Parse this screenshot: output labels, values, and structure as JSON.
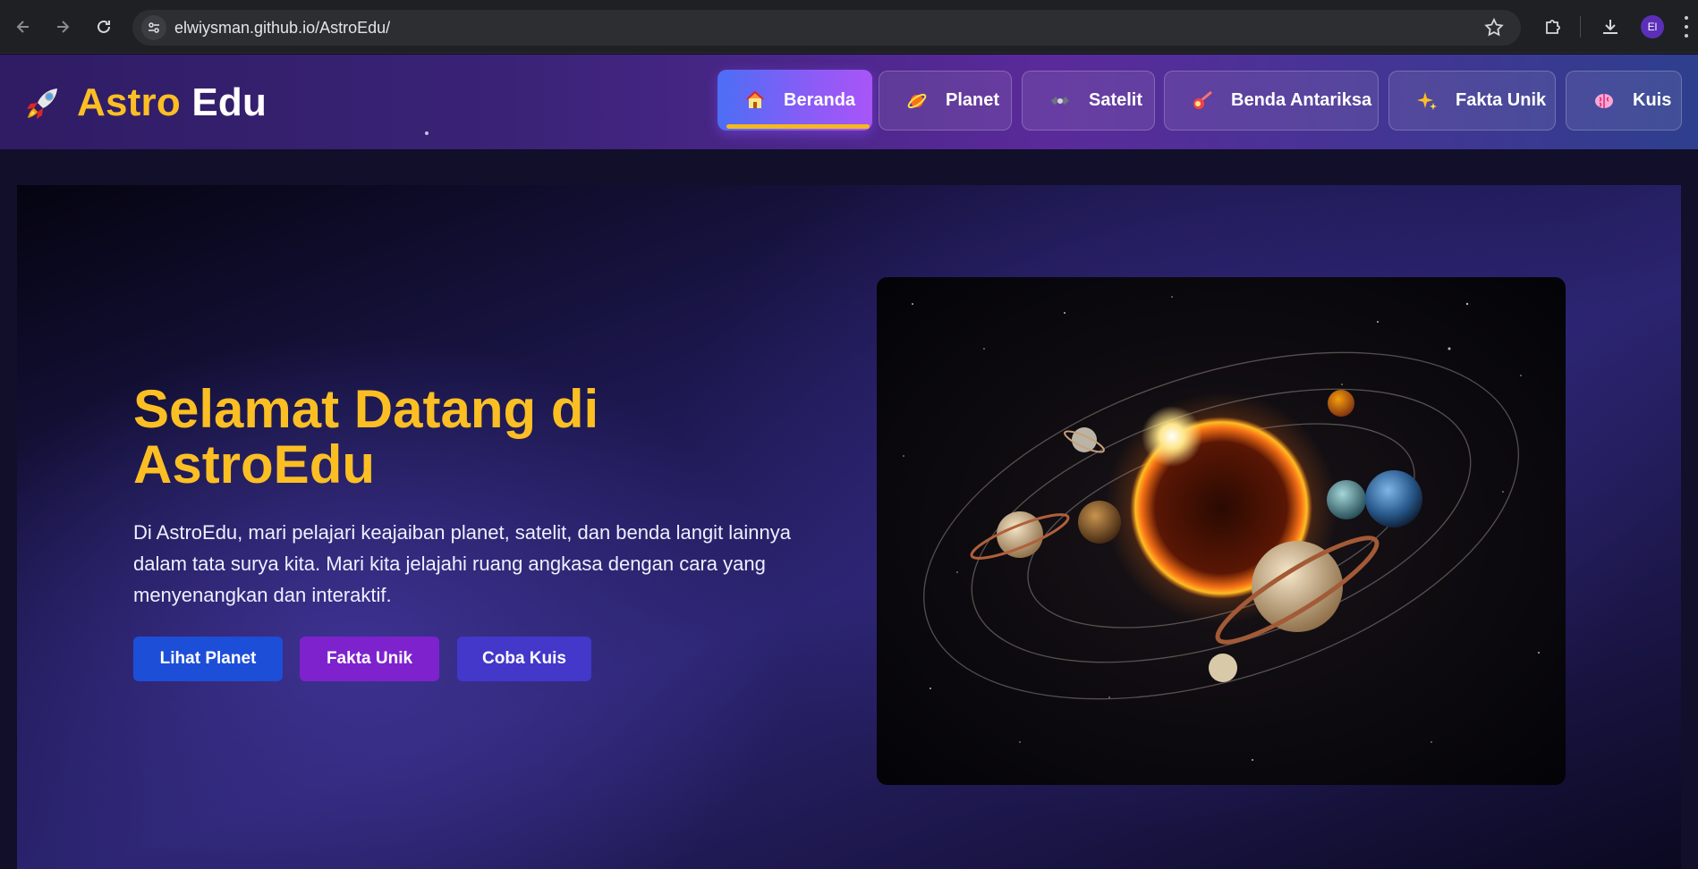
{
  "browser": {
    "url": "elwiysman.github.io/AstroEdu/",
    "profile_initials": "El"
  },
  "header": {
    "logo_word_1": "Astro",
    "logo_word_2": "Edu",
    "nav": [
      {
        "label": "Beranda",
        "icon": "house-icon",
        "active": true
      },
      {
        "label": "Planet",
        "icon": "planet-icon",
        "active": false
      },
      {
        "label": "Satelit",
        "icon": "satellite-icon",
        "active": false
      },
      {
        "label": "Benda Antariksa",
        "icon": "comet-icon",
        "active": false
      },
      {
        "label": "Fakta Unik",
        "icon": "sparkles-icon",
        "active": false
      },
      {
        "label": "Kuis",
        "icon": "brain-icon",
        "active": false
      }
    ]
  },
  "hero": {
    "title": "Selamat Datang di AstroEdu",
    "description": "Di AstroEdu, mari pelajari keajaiban planet, satelit, dan benda langit lainnya dalam tata surya kita. Mari kita jelajahi ruang angkasa dengan cara yang menyenangkan dan interaktif.",
    "buttons": {
      "planet": "Lihat Planet",
      "fakta": "Fakta Unik",
      "kuis": "Coba Kuis"
    }
  },
  "colors": {
    "accent_yellow": "#fbbf24",
    "btn_planet": "#1d4ed8",
    "btn_fakta": "#7e22ce",
    "btn_kuis": "#4338ca"
  }
}
